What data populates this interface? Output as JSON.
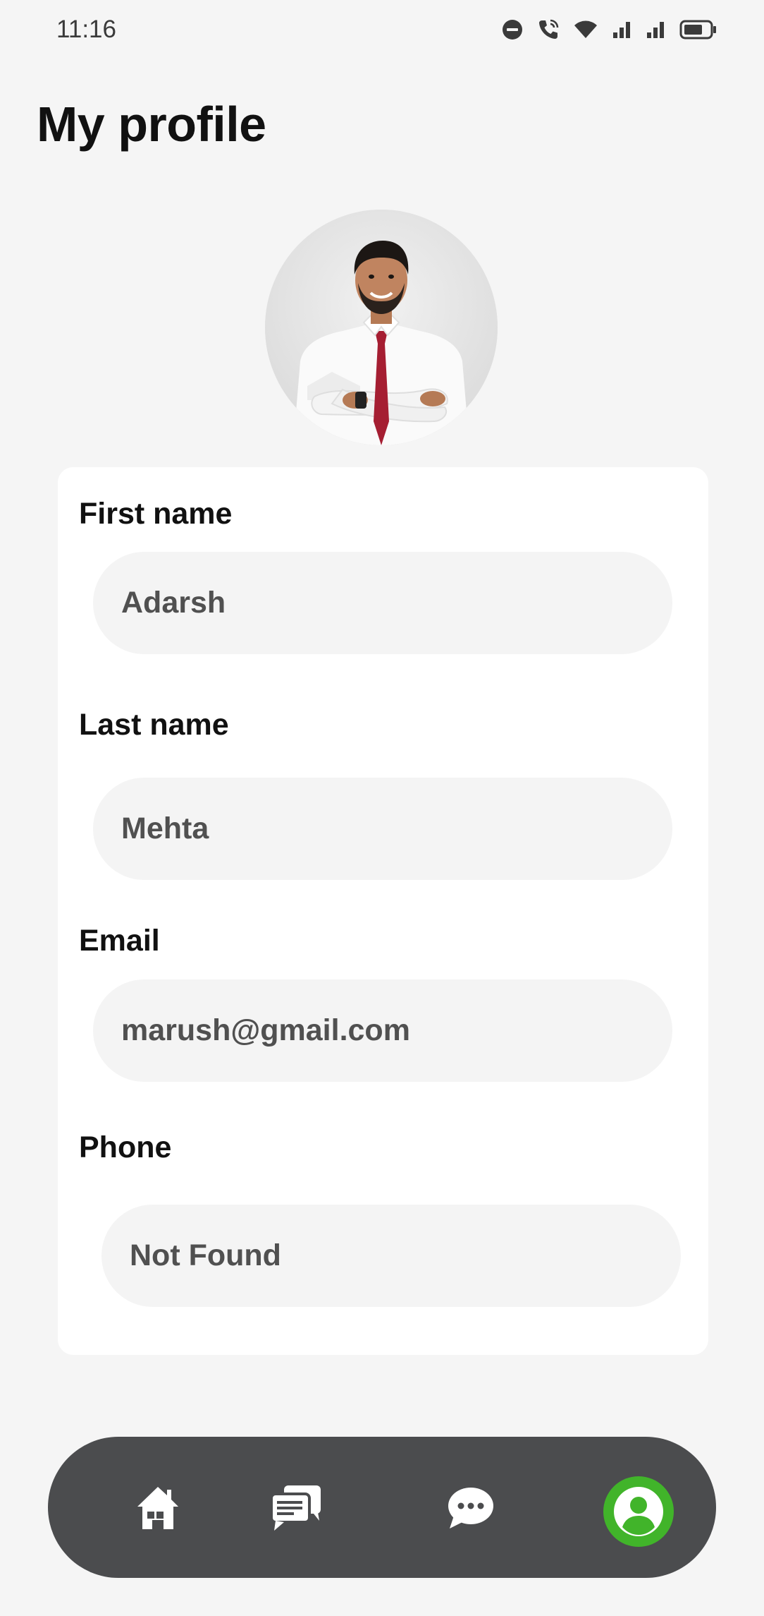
{
  "status_bar": {
    "time": "11:16",
    "icons": [
      "do-not-disturb-icon",
      "wifi-calling-icon",
      "wifi-icon",
      "signal-icon",
      "signal-icon",
      "battery-icon"
    ]
  },
  "page": {
    "title": "My profile"
  },
  "profile": {
    "avatar_icon": "profile-photo",
    "fields": {
      "first_name": {
        "label": "First name",
        "value": "Adarsh"
      },
      "last_name": {
        "label": "Last name",
        "value": "Mehta"
      },
      "email": {
        "label": "Email",
        "value": "marush@gmail.com"
      },
      "phone": {
        "label": "Phone",
        "value": "Not Found"
      }
    }
  },
  "bottom_nav": {
    "items": [
      {
        "icon": "home-icon"
      },
      {
        "icon": "forum-icon"
      },
      {
        "icon": "chat-bubble-icon"
      },
      {
        "icon": "profile-icon",
        "active": true
      }
    ],
    "active_color": "#41b42a",
    "bar_color": "#4b4c4e"
  }
}
